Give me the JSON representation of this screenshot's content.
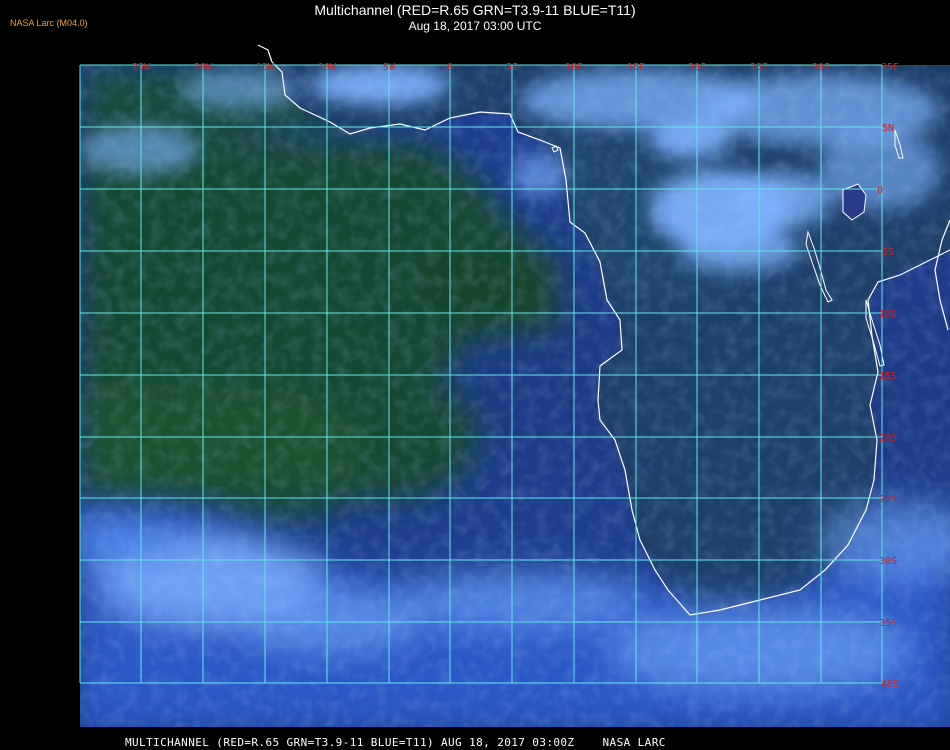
{
  "header": {
    "agency_tag": "NASA Larc (M04.0)",
    "title": "Multichannel (RED=R.65 GRN=T3.9-11 BLUE=T11)",
    "datetime": "Aug 18, 2017 03:00 UTC"
  },
  "footer": {
    "caption": "MULTICHANNEL (RED=R.65 GRN=T3.9-11 BLUE=T11) AUG 18, 2017 03:00Z    NASA LARC"
  },
  "map": {
    "longitude_labels": [
      "25W",
      "20W",
      "15W",
      "10W",
      "5W",
      "0",
      "5E",
      "10E",
      "15E",
      "20E",
      "25E",
      "30E",
      "35E"
    ],
    "latitude_labels": [
      "5N",
      "0",
      "5S",
      "10S",
      "15S",
      "20S",
      "25S",
      "30S",
      "35S",
      "40S"
    ],
    "colors": {
      "grid": "#5ee8e8",
      "coast": "#ffffff",
      "ocean": "#1e3a8a",
      "land_night": "#173f2c",
      "cloud": "#6fa8ff",
      "label": "#d02020"
    }
  }
}
